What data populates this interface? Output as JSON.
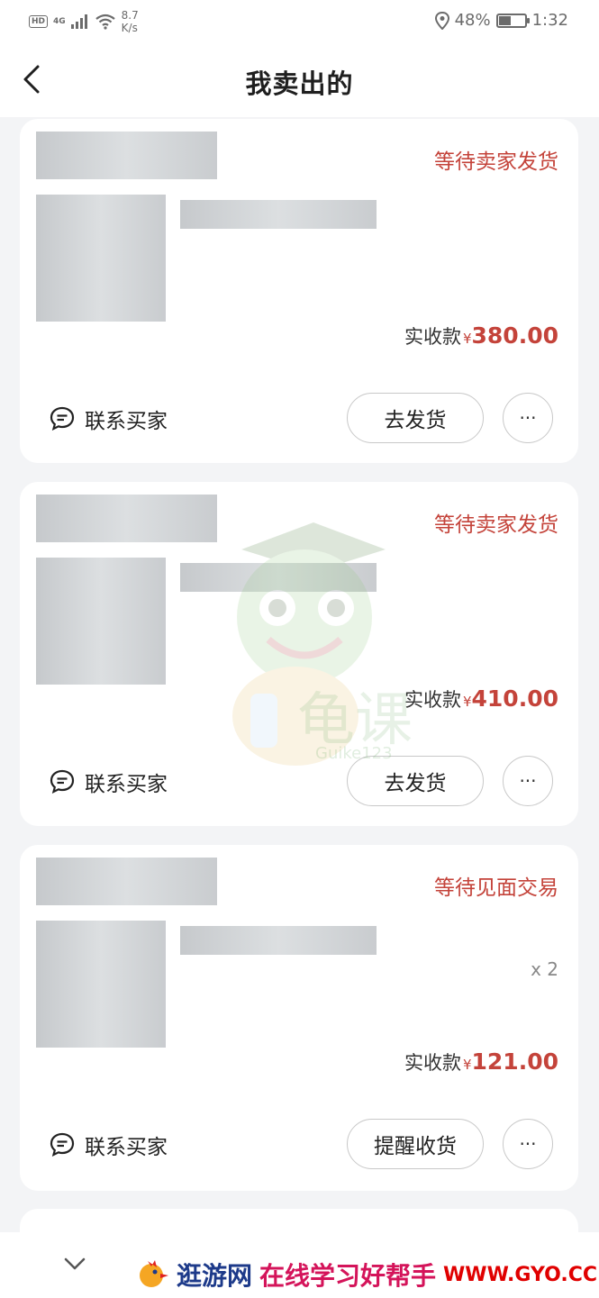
{
  "status_bar": {
    "hd": "HD",
    "network": "4G",
    "speed_value": "8.7",
    "speed_unit": "K/s",
    "battery_percent": "48%",
    "battery_level": 0.48,
    "time": "1:32"
  },
  "header": {
    "title": "我卖出的"
  },
  "orders": [
    {
      "status": "等待卖家发货",
      "qty": "",
      "amount_label": "实收款",
      "currency": "¥",
      "amount": "380.00",
      "contact_label": "联系买家",
      "action_label": "去发货",
      "more_label": "···"
    },
    {
      "status": "等待卖家发货",
      "qty": "",
      "amount_label": "实收款",
      "currency": "¥",
      "amount": "410.00",
      "contact_label": "联系买家",
      "action_label": "去发货",
      "more_label": "···"
    },
    {
      "status": "等待见面交易",
      "qty": "x 2",
      "amount_label": "实收款",
      "currency": "¥",
      "amount": "121.00",
      "contact_label": "联系买家",
      "action_label": "提醒收货",
      "more_label": "···"
    }
  ],
  "watermark": {
    "text": "龟课",
    "sub": "Guike123"
  },
  "banner": {
    "site_name": "逛游网",
    "slogan": "在线学习好帮手",
    "url": "WWW.GYO.CC"
  },
  "colors": {
    "accent": "#c4433a",
    "background": "#f3f4f6",
    "card": "#ffffff"
  }
}
